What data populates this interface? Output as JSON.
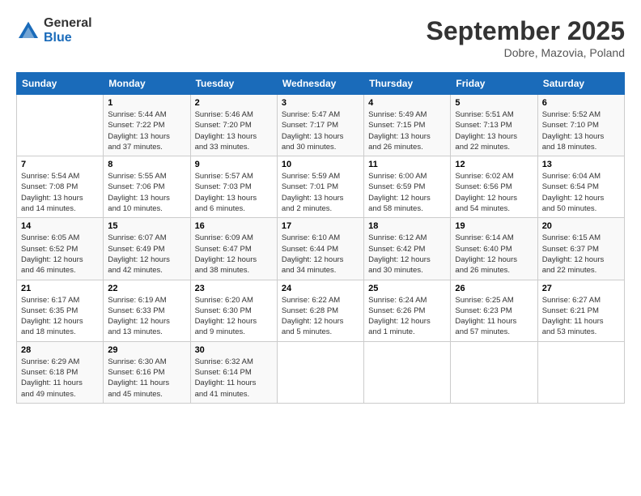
{
  "logo": {
    "general": "General",
    "blue": "Blue"
  },
  "title": "September 2025",
  "location": "Dobre, Mazovia, Poland",
  "days_of_week": [
    "Sunday",
    "Monday",
    "Tuesday",
    "Wednesday",
    "Thursday",
    "Friday",
    "Saturday"
  ],
  "weeks": [
    [
      {
        "day": "",
        "info": ""
      },
      {
        "day": "1",
        "info": "Sunrise: 5:44 AM\nSunset: 7:22 PM\nDaylight: 13 hours\nand 37 minutes."
      },
      {
        "day": "2",
        "info": "Sunrise: 5:46 AM\nSunset: 7:20 PM\nDaylight: 13 hours\nand 33 minutes."
      },
      {
        "day": "3",
        "info": "Sunrise: 5:47 AM\nSunset: 7:17 PM\nDaylight: 13 hours\nand 30 minutes."
      },
      {
        "day": "4",
        "info": "Sunrise: 5:49 AM\nSunset: 7:15 PM\nDaylight: 13 hours\nand 26 minutes."
      },
      {
        "day": "5",
        "info": "Sunrise: 5:51 AM\nSunset: 7:13 PM\nDaylight: 13 hours\nand 22 minutes."
      },
      {
        "day": "6",
        "info": "Sunrise: 5:52 AM\nSunset: 7:10 PM\nDaylight: 13 hours\nand 18 minutes."
      }
    ],
    [
      {
        "day": "7",
        "info": "Sunrise: 5:54 AM\nSunset: 7:08 PM\nDaylight: 13 hours\nand 14 minutes."
      },
      {
        "day": "8",
        "info": "Sunrise: 5:55 AM\nSunset: 7:06 PM\nDaylight: 13 hours\nand 10 minutes."
      },
      {
        "day": "9",
        "info": "Sunrise: 5:57 AM\nSunset: 7:03 PM\nDaylight: 13 hours\nand 6 minutes."
      },
      {
        "day": "10",
        "info": "Sunrise: 5:59 AM\nSunset: 7:01 PM\nDaylight: 13 hours\nand 2 minutes."
      },
      {
        "day": "11",
        "info": "Sunrise: 6:00 AM\nSunset: 6:59 PM\nDaylight: 12 hours\nand 58 minutes."
      },
      {
        "day": "12",
        "info": "Sunrise: 6:02 AM\nSunset: 6:56 PM\nDaylight: 12 hours\nand 54 minutes."
      },
      {
        "day": "13",
        "info": "Sunrise: 6:04 AM\nSunset: 6:54 PM\nDaylight: 12 hours\nand 50 minutes."
      }
    ],
    [
      {
        "day": "14",
        "info": "Sunrise: 6:05 AM\nSunset: 6:52 PM\nDaylight: 12 hours\nand 46 minutes."
      },
      {
        "day": "15",
        "info": "Sunrise: 6:07 AM\nSunset: 6:49 PM\nDaylight: 12 hours\nand 42 minutes."
      },
      {
        "day": "16",
        "info": "Sunrise: 6:09 AM\nSunset: 6:47 PM\nDaylight: 12 hours\nand 38 minutes."
      },
      {
        "day": "17",
        "info": "Sunrise: 6:10 AM\nSunset: 6:44 PM\nDaylight: 12 hours\nand 34 minutes."
      },
      {
        "day": "18",
        "info": "Sunrise: 6:12 AM\nSunset: 6:42 PM\nDaylight: 12 hours\nand 30 minutes."
      },
      {
        "day": "19",
        "info": "Sunrise: 6:14 AM\nSunset: 6:40 PM\nDaylight: 12 hours\nand 26 minutes."
      },
      {
        "day": "20",
        "info": "Sunrise: 6:15 AM\nSunset: 6:37 PM\nDaylight: 12 hours\nand 22 minutes."
      }
    ],
    [
      {
        "day": "21",
        "info": "Sunrise: 6:17 AM\nSunset: 6:35 PM\nDaylight: 12 hours\nand 18 minutes."
      },
      {
        "day": "22",
        "info": "Sunrise: 6:19 AM\nSunset: 6:33 PM\nDaylight: 12 hours\nand 13 minutes."
      },
      {
        "day": "23",
        "info": "Sunrise: 6:20 AM\nSunset: 6:30 PM\nDaylight: 12 hours\nand 9 minutes."
      },
      {
        "day": "24",
        "info": "Sunrise: 6:22 AM\nSunset: 6:28 PM\nDaylight: 12 hours\nand 5 minutes."
      },
      {
        "day": "25",
        "info": "Sunrise: 6:24 AM\nSunset: 6:26 PM\nDaylight: 12 hours\nand 1 minute."
      },
      {
        "day": "26",
        "info": "Sunrise: 6:25 AM\nSunset: 6:23 PM\nDaylight: 11 hours\nand 57 minutes."
      },
      {
        "day": "27",
        "info": "Sunrise: 6:27 AM\nSunset: 6:21 PM\nDaylight: 11 hours\nand 53 minutes."
      }
    ],
    [
      {
        "day": "28",
        "info": "Sunrise: 6:29 AM\nSunset: 6:18 PM\nDaylight: 11 hours\nand 49 minutes."
      },
      {
        "day": "29",
        "info": "Sunrise: 6:30 AM\nSunset: 6:16 PM\nDaylight: 11 hours\nand 45 minutes."
      },
      {
        "day": "30",
        "info": "Sunrise: 6:32 AM\nSunset: 6:14 PM\nDaylight: 11 hours\nand 41 minutes."
      },
      {
        "day": "",
        "info": ""
      },
      {
        "day": "",
        "info": ""
      },
      {
        "day": "",
        "info": ""
      },
      {
        "day": "",
        "info": ""
      }
    ]
  ]
}
